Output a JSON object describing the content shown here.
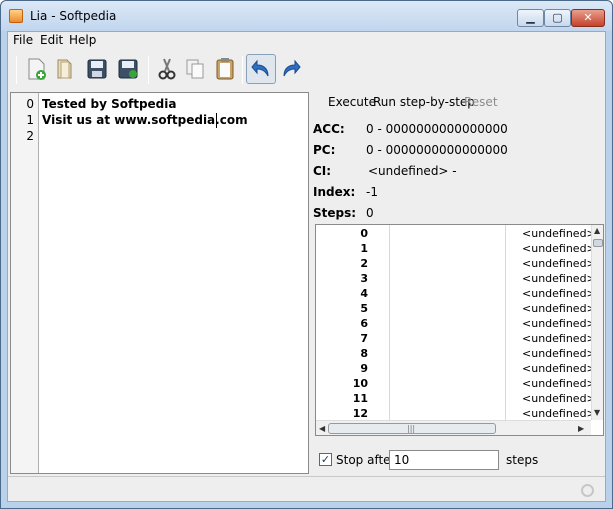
{
  "window": {
    "title": "Lia - Softpedia"
  },
  "menu": {
    "items": [
      "File",
      "Edit",
      "Help"
    ]
  },
  "toolbar": {
    "buttons": [
      "new-file-icon",
      "open-file-icon",
      "save-icon",
      "save-as-icon",
      "cut-icon",
      "copy-icon",
      "paste-icon",
      "undo-icon",
      "redo-icon"
    ]
  },
  "editor": {
    "lines": [
      {
        "num": "0",
        "text": "Tested by Softpedia"
      },
      {
        "num": "1",
        "text": "Visit us at www.softpedia.com"
      },
      {
        "num": "2",
        "text": ""
      }
    ]
  },
  "actions": {
    "execute": "Execute",
    "run_step": "Run step-by-step",
    "reset": "Reset"
  },
  "registers": {
    "acc_label": "ACC:",
    "acc_value": "0 - 0000000000000000",
    "pc_label": "PC:",
    "pc_value": "0 - 0000000000000000",
    "ci_label": "CI:",
    "ci_value": "<undefined> -",
    "index_label": "Index:",
    "index_value": "-1",
    "steps_label": "Steps:",
    "steps_value": "0"
  },
  "memory": {
    "rows": [
      {
        "addr": "0",
        "value": "<undefined>"
      },
      {
        "addr": "1",
        "value": "<undefined>"
      },
      {
        "addr": "2",
        "value": "<undefined>"
      },
      {
        "addr": "3",
        "value": "<undefined>"
      },
      {
        "addr": "4",
        "value": "<undefined>"
      },
      {
        "addr": "5",
        "value": "<undefined>"
      },
      {
        "addr": "6",
        "value": "<undefined>"
      },
      {
        "addr": "7",
        "value": "<undefined>"
      },
      {
        "addr": "8",
        "value": "<undefined>"
      },
      {
        "addr": "9",
        "value": "<undefined>"
      },
      {
        "addr": "10",
        "value": "<undefined>"
      },
      {
        "addr": "11",
        "value": "<undefined>"
      },
      {
        "addr": "12",
        "value": "<undefined>"
      }
    ]
  },
  "stop": {
    "label": "Stop after",
    "value": "10",
    "suffix": "steps",
    "checked": true
  },
  "colors": {
    "accent": "#1f6fd1",
    "disabled": "#8c8c8c"
  }
}
